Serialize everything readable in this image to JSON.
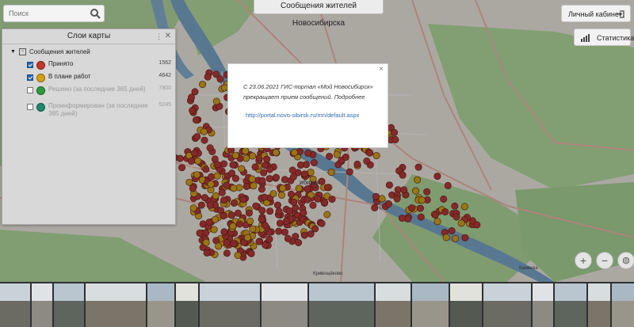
{
  "header": {
    "title": "Сообщения жителей Новосибирска"
  },
  "search": {
    "placeholder": "Поиск",
    "icon": "search-icon"
  },
  "account": {
    "label": "Личный кабинет",
    "icon": "login-icon"
  },
  "statistics": {
    "label": "Статистика",
    "icon": "bar-chart-icon"
  },
  "layers_panel": {
    "title": "Слои карты",
    "group": "Сообщения жителей",
    "items": [
      {
        "label": "Принято",
        "count": "1562",
        "color": "#c0392b",
        "checked": true
      },
      {
        "label": "В плане работ",
        "count": "4642",
        "color": "#d4a017",
        "checked": true
      },
      {
        "label": "Решено (за последние 365 дней)",
        "count": "7900",
        "color": "#2e9d3c",
        "checked": false
      },
      {
        "label": "Проинформирован (за последние 365 дней)",
        "count": "5245",
        "color": "#1f8a70",
        "checked": false
      }
    ]
  },
  "notice": {
    "text": "С 23.06.2021 ГИС-портал «Мой Новосибирск» прекращает прием сообщений. Подробнее",
    "link": "http://portal.novo-sibirsk.ru/mn/default.aspx",
    "close": "×"
  },
  "map": {
    "labels": {
      "city": "ибирск",
      "district": "Кривощёково",
      "district2": "Каменка"
    },
    "colors": {
      "accepted": "#b83a3a",
      "planned": "#d3a21e",
      "water": "#7aa6c9",
      "park": "#9ed08a"
    }
  },
  "zoom": {
    "in": "+",
    "out": "−",
    "globe": "globe-icon"
  }
}
